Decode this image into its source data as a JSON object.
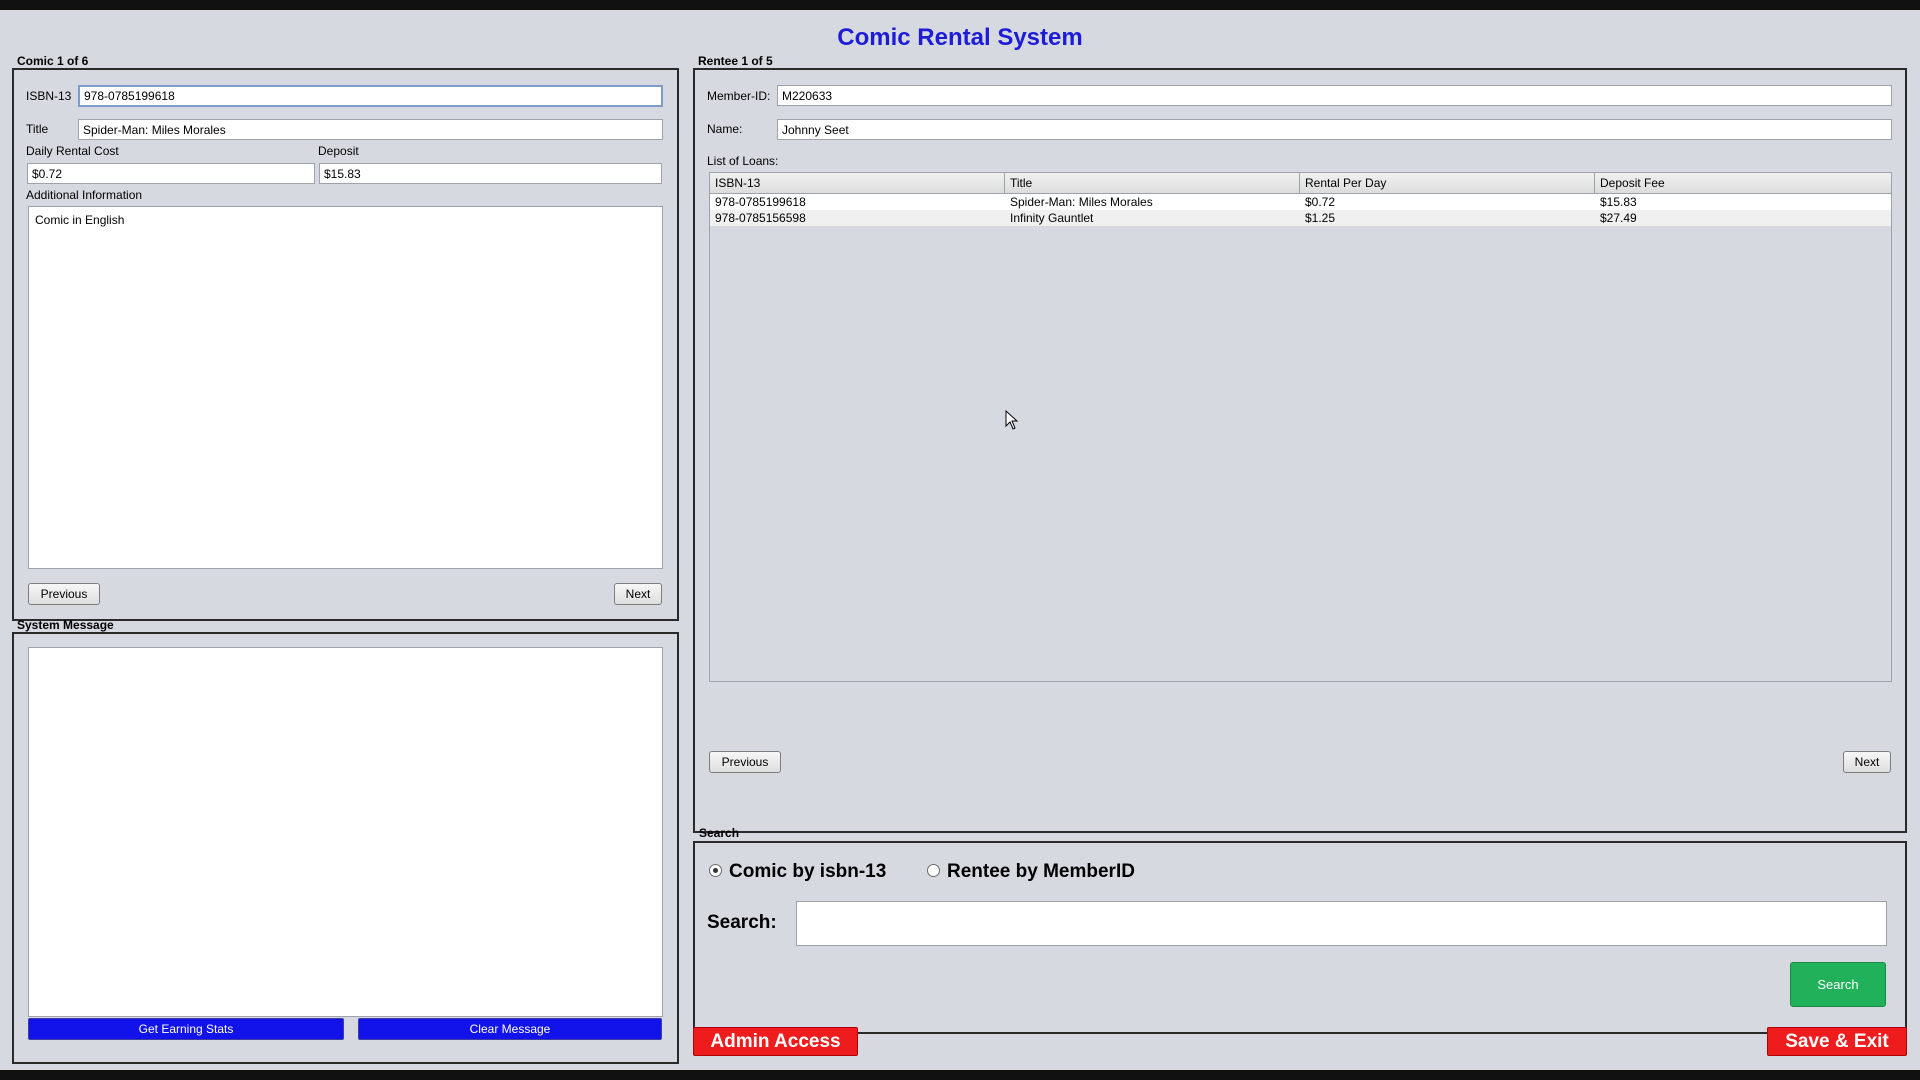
{
  "app_title": "Comic Rental System",
  "comic_panel": {
    "label": "Comic 1 of 6",
    "isbn_label": "ISBN-13",
    "isbn_value": "978-0785199618",
    "title_label": "Title",
    "title_value": "Spider-Man: Miles Morales",
    "daily_cost_label": "Daily Rental Cost",
    "daily_cost_value": "$0.72",
    "deposit_label": "Deposit",
    "deposit_value": "$15.83",
    "additional_label": "Additional Information",
    "additional_value": "Comic in English",
    "previous_label": "Previous",
    "next_label": "Next"
  },
  "system_panel": {
    "label": "System Message",
    "message": "",
    "stats_button": "Get Earning Stats",
    "clear_button": "Clear Message"
  },
  "rentee_panel": {
    "label": "Rentee 1 of 5",
    "member_id_label": "Member-ID:",
    "member_id_value": "M220633",
    "name_label": "Name:",
    "name_value": "Johnny Seet",
    "loans_label": "List of Loans:",
    "columns": [
      "ISBN-13",
      "Title",
      "Rental Per Day",
      "Deposit Fee"
    ],
    "rows": [
      [
        "978-0785199618",
        "Spider-Man: Miles Morales",
        "$0.72",
        "$15.83"
      ],
      [
        "978-0785156598",
        "Infinity Gauntlet",
        "$1.25",
        "$27.49"
      ]
    ],
    "previous_label": "Previous",
    "next_label": "Next"
  },
  "search_panel": {
    "label": "Search",
    "option_comic": "Comic by isbn-13",
    "option_rentee": "Rentee by MemberID",
    "selected_option": "comic",
    "search_label": "Search:",
    "search_value": "",
    "search_button": "Search"
  },
  "footer": {
    "admin_button": "Admin Access",
    "save_exit_button": "Save & Exit"
  },
  "colors": {
    "title": "#1d1dd8",
    "blue_button": "#1212ea",
    "green_button": "#21b15b",
    "red_button": "#ee1c1c",
    "background": "#d6d9df"
  }
}
